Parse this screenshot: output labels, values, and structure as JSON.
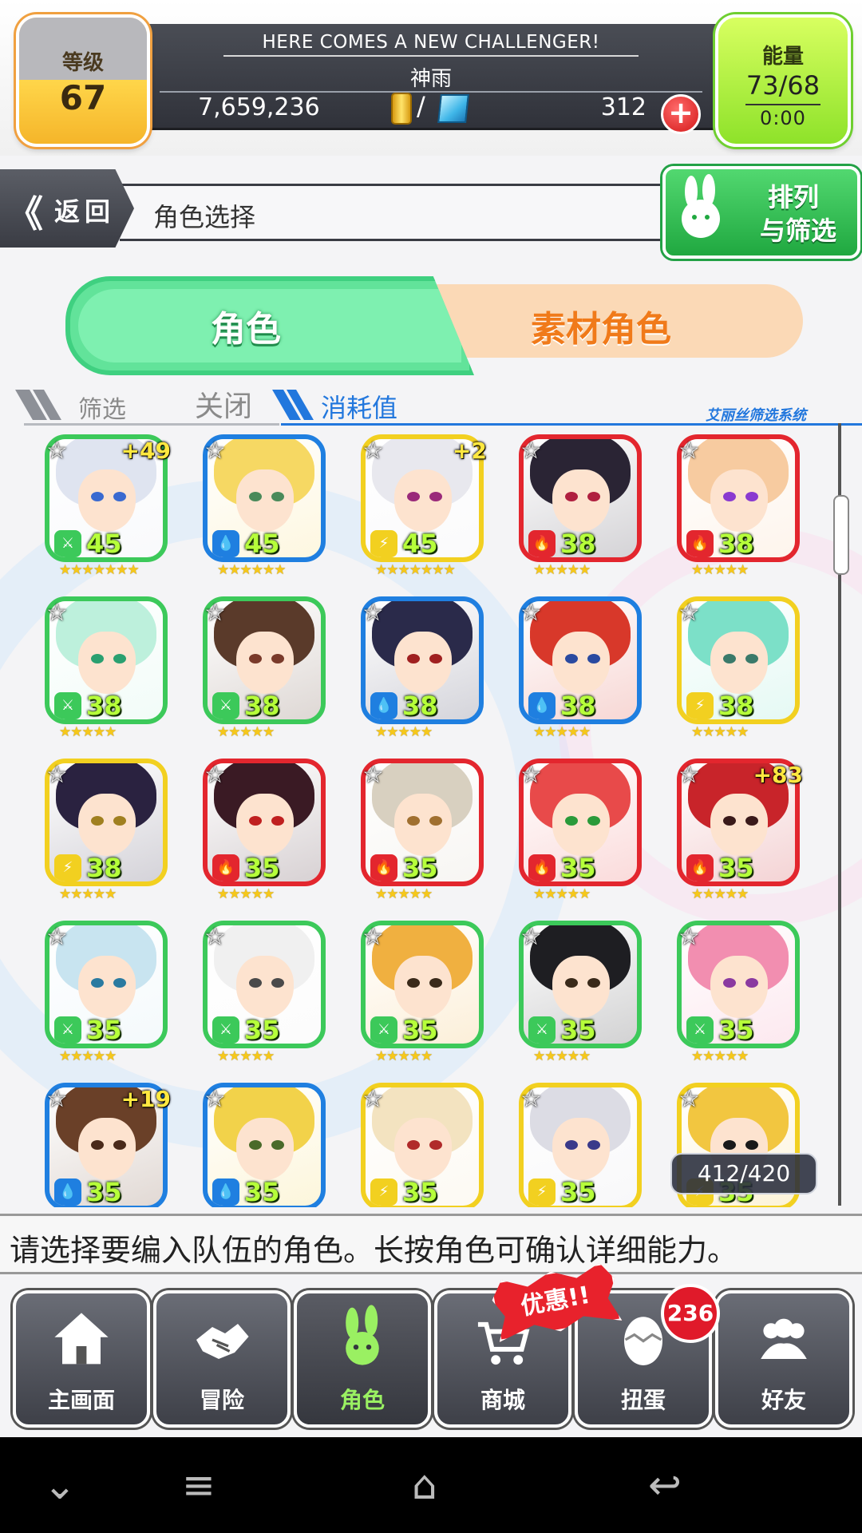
{
  "header": {
    "level_label": "等级",
    "level_value": "67",
    "challenger_text": "HERE COMES A NEW CHALLENGER!",
    "player_name": "神雨",
    "gold": "7,659,236",
    "currency_separator": "/",
    "gems": "312",
    "add_gems_symbol": "+",
    "energy_label": "能量",
    "energy_value": "73/68",
    "energy_timer": "0:00"
  },
  "nav": {
    "back_chevron": "《",
    "back_label": "返回",
    "screen_title": "角色选择",
    "sort_label_1": "排列",
    "sort_label_2": "与筛选"
  },
  "tabs": {
    "characters": "角色",
    "material": "素材角色"
  },
  "filter": {
    "filter_label": "筛选",
    "filter_state": "关闭",
    "sort_key": "消耗值",
    "system_label": "艾丽丝筛选系统"
  },
  "colors": {
    "wind": "#3cc95a",
    "water": "#1f7fe0",
    "thunder": "#f2d020",
    "fire": "#e3262e",
    "accent_green": "#62e39a",
    "accent_orange": "#f07a1a",
    "accent_blue": "#2277dd"
  },
  "characters": [
    {
      "element": "wind",
      "level": "45",
      "plus": "+49",
      "stars": "★★★★★★★",
      "hair": "#dfe4f0",
      "eye": "#3a6ad0"
    },
    {
      "element": "water",
      "level": "45",
      "plus": "",
      "stars": "★★★★★★",
      "hair": "#f6d863",
      "eye": "#4a8a5a"
    },
    {
      "element": "thunder",
      "level": "45",
      "plus": "+2",
      "stars": "★★★★★★★",
      "hair": "#e8e8ee",
      "eye": "#9a2a7a"
    },
    {
      "element": "fire",
      "level": "38",
      "plus": "",
      "stars": "★★★★★",
      "hair": "#2a2434",
      "eye": "#b02040"
    },
    {
      "element": "fire",
      "level": "38",
      "plus": "",
      "stars": "★★★★★",
      "hair": "#f7cba0",
      "eye": "#8a3ad0"
    },
    {
      "element": "wind",
      "level": "38",
      "plus": "",
      "stars": "★★★★★",
      "hair": "#bdf0dc",
      "eye": "#2aa070"
    },
    {
      "element": "wind",
      "level": "38",
      "plus": "",
      "stars": "★★★★★",
      "hair": "#5a3a2a",
      "eye": "#7a3a2a"
    },
    {
      "element": "water",
      "level": "38",
      "plus": "",
      "stars": "★★★★★",
      "hair": "#2a2a4a",
      "eye": "#a02020"
    },
    {
      "element": "water",
      "level": "38",
      "plus": "",
      "stars": "★★★★★",
      "hair": "#d8382a",
      "eye": "#2a4aa0"
    },
    {
      "element": "thunder",
      "level": "38",
      "plus": "",
      "stars": "★★★★★",
      "hair": "#7ce0c8",
      "eye": "#3a7a6a"
    },
    {
      "element": "thunder",
      "level": "38",
      "plus": "",
      "stars": "★★★★★",
      "hair": "#2a2240",
      "eye": "#a08020"
    },
    {
      "element": "fire",
      "level": "35",
      "plus": "",
      "stars": "★★★★★",
      "hair": "#3a1a24",
      "eye": "#c02020"
    },
    {
      "element": "fire",
      "level": "35",
      "plus": "",
      "stars": "★★★★★",
      "hair": "#d8d0c0",
      "eye": "#a07030"
    },
    {
      "element": "fire",
      "level": "35",
      "plus": "",
      "stars": "★★★★★",
      "hair": "#e84a4a",
      "eye": "#2a9a3a"
    },
    {
      "element": "fire",
      "level": "35",
      "plus": "+83",
      "stars": "★★★★★",
      "hair": "#c8242a",
      "eye": "#3a1a1a"
    },
    {
      "element": "wind",
      "level": "35",
      "plus": "",
      "stars": "★★★★★",
      "hair": "#c8e4f0",
      "eye": "#2a7aa0"
    },
    {
      "element": "wind",
      "level": "35",
      "plus": "",
      "stars": "★★★★★",
      "hair": "#f0f0f0",
      "eye": "#4a4a4a"
    },
    {
      "element": "wind",
      "level": "35",
      "plus": "",
      "stars": "★★★★★",
      "hair": "#f0b040",
      "eye": "#3a2a1a"
    },
    {
      "element": "wind",
      "level": "35",
      "plus": "",
      "stars": "★★★★★",
      "hair": "#1e1e22",
      "eye": "#3a2a1a"
    },
    {
      "element": "wind",
      "level": "35",
      "plus": "",
      "stars": "★★★★★",
      "hair": "#f28eb0",
      "eye": "#8a3aa0"
    },
    {
      "element": "water",
      "level": "35",
      "plus": "+19",
      "stars": "★★★★★",
      "hair": "#6a4028",
      "eye": "#4a2a1a"
    },
    {
      "element": "water",
      "level": "35",
      "plus": "",
      "stars": "★★★★★",
      "hair": "#f2d24a",
      "eye": "#4a6a2a"
    },
    {
      "element": "thunder",
      "level": "35",
      "plus": "",
      "stars": "★★★★★",
      "hair": "#f3e3c0",
      "eye": "#b02a2a"
    },
    {
      "element": "thunder",
      "level": "35",
      "plus": "",
      "stars": "★★★★★",
      "hair": "#dcdce4",
      "eye": "#3a3a8a"
    },
    {
      "element": "thunder",
      "level": "35",
      "plus": "",
      "stars": "★★★★★",
      "hair": "#f2c640",
      "eye": "#1a1a1a"
    }
  ],
  "roster_count": "412/420",
  "hint": "请选择要编入队伍的角色。长按角色可确认详细能力。",
  "bottom_nav": [
    {
      "label": "主画面",
      "icon": "home-icon"
    },
    {
      "label": "冒险",
      "icon": "handshake-icon"
    },
    {
      "label": "角色",
      "icon": "bunny-icon",
      "active": true
    },
    {
      "label": "商城",
      "icon": "cart-icon"
    },
    {
      "label": "扭蛋",
      "icon": "egg-icon"
    },
    {
      "label": "好友",
      "icon": "friends-icon"
    }
  ],
  "sale_label": "优惠!!",
  "gacha_badge": "236",
  "android_nav": {
    "down": "⌄",
    "menu": "≡",
    "home": "⌂",
    "back": "↩"
  }
}
